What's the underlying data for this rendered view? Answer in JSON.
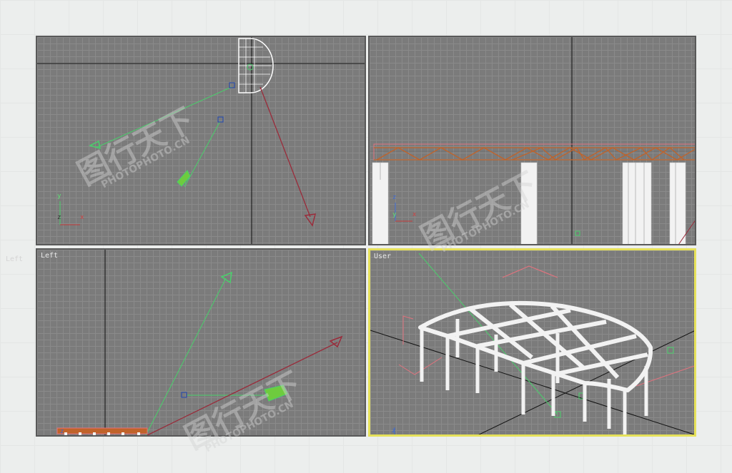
{
  "viewports": {
    "top": {
      "label": ""
    },
    "front": {
      "label": ""
    },
    "left": {
      "label": "Left"
    },
    "perspective": {
      "label": "User"
    }
  },
  "axis_labels": {
    "x": "x",
    "y": "y",
    "z": "z"
  },
  "outside_label": "Left",
  "watermark": {
    "brand": "图行天下",
    "url": "PHOTOPHOTO.CN"
  },
  "colors": {
    "viewport_bg": "#7b7b7b",
    "grid_line": "#8a8a8a",
    "active_border": "#e6e15a",
    "camera_green": "#49d06b",
    "light_red": "#9a2b3a",
    "structure_orange": "#c0632a",
    "geometry_white": "#f2f2f2"
  }
}
